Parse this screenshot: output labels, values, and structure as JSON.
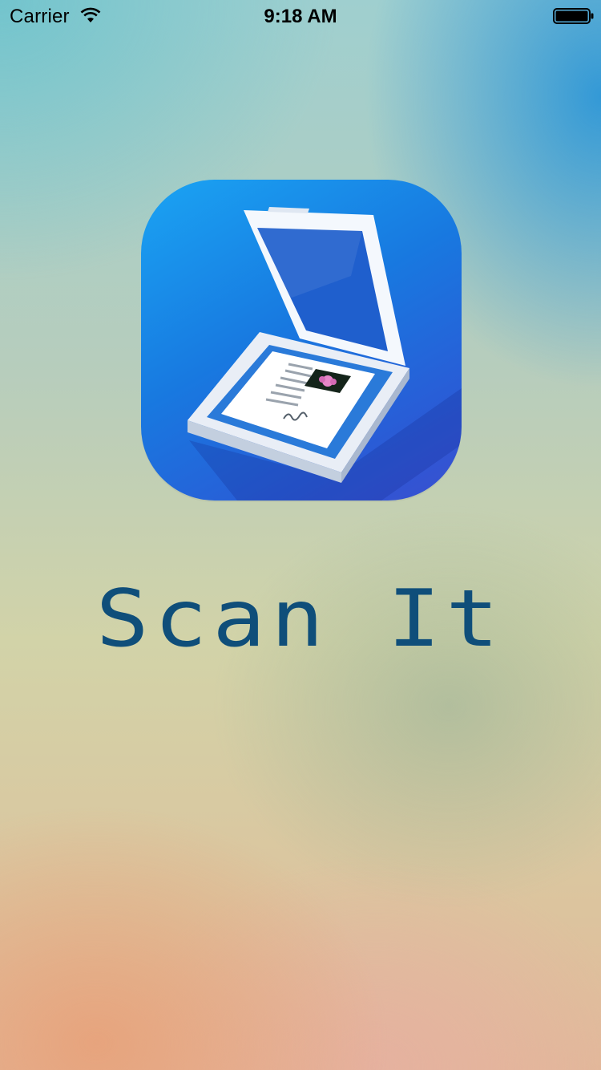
{
  "status_bar": {
    "carrier": "Carrier",
    "time": "9:18 AM",
    "wifi_icon": "wifi-icon",
    "battery_icon": "battery-icon"
  },
  "app": {
    "title": "Scan It",
    "title_color": "#0f4e7a",
    "icon": "scanner-icon",
    "icon_colors": {
      "top": "#1aa4f3",
      "bottom": "#3a4fd0"
    }
  }
}
